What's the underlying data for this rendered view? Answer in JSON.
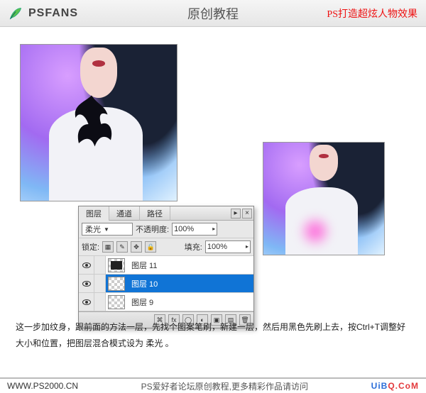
{
  "header": {
    "logo": "PSFANS",
    "title": "原创教程",
    "subtitle": "PS打造超炫人物效果"
  },
  "panel": {
    "tabs": [
      "图层",
      "通道",
      "路径"
    ],
    "active_tab": 0,
    "blend_mode": "柔光",
    "opacity_label": "不透明度:",
    "opacity_value": "100%",
    "lock_label": "锁定:",
    "fill_label": "填充:",
    "fill_value": "100%",
    "layers": [
      {
        "visible": true,
        "name": "图层 11",
        "thumb": "dark",
        "selected": false
      },
      {
        "visible": true,
        "name": "图层 10",
        "thumb": "checker",
        "selected": true
      },
      {
        "visible": true,
        "name": "图层 9",
        "thumb": "checker",
        "selected": false
      }
    ],
    "footer_icons": [
      "link-icon",
      "fx-icon",
      "mask-icon",
      "folder-icon",
      "adjust-icon",
      "new-icon",
      "trash-icon"
    ]
  },
  "description": "这一步加纹身，跟前面的方法一层，先找个图案笔刷，新建一层，然后用黑色先刷上去，按Ctrl+T调整好大小和位置，把图层混合模式设为 柔光 。",
  "footer": {
    "url": "WWW.PS2000.CN",
    "credit": "PS爱好者论坛原创教程,更多精彩作品请访问",
    "brand_a": "UiB",
    "brand_b": "Q.CoM"
  }
}
